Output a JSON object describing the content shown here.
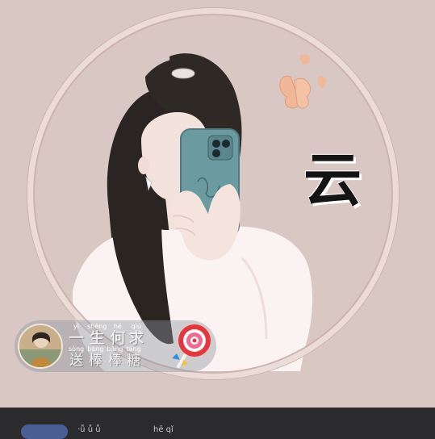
{
  "avatar": {
    "calligraphy_char": "云",
    "alt": "avatar-illustration"
  },
  "pendant": {
    "line1": [
      {
        "py": "yī",
        "hz": "一"
      },
      {
        "py": "shēng",
        "hz": "生"
      },
      {
        "py": "hé",
        "hz": "何"
      },
      {
        "py": "qiú",
        "hz": "求"
      }
    ],
    "line2": [
      {
        "py": "sòng",
        "hz": "送"
      },
      {
        "py": "bàng",
        "hz": "棒"
      },
      {
        "py": "bàng",
        "hz": "棒"
      },
      {
        "py": "táng",
        "hz": "糖"
      }
    ]
  },
  "colors": {
    "background": "#d8c7c3",
    "ring": "#ecdcd8",
    "bottom_bar": "#2b2b2e",
    "accent_pill": "#4b5e93"
  },
  "bottom": {
    "text_a": "·ǚ ǚ ǚ",
    "text_b": "hē qǐ"
  }
}
